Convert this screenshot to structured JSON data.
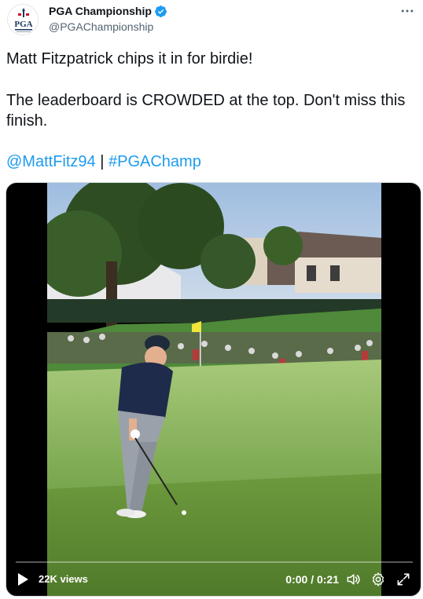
{
  "author": {
    "display_name": "PGA Championship",
    "handle": "@PGAChampionship",
    "avatar_lettering": "PGA"
  },
  "tweet": {
    "line1": "Matt Fitzpatrick chips it in for birdie!",
    "line2": "The leaderboard is CROWDED at the top. Don't miss this finish.",
    "mention": "@MattFitz94",
    "separator": " | ",
    "hashtag": "#PGAChamp"
  },
  "video": {
    "views": "22K views",
    "time": "0:00 / 0:21",
    "progress": 0
  },
  "icons": {
    "more": "more-horizontal-icon",
    "verified": "verified-badge-icon",
    "play": "play-icon",
    "volume": "volume-icon",
    "settings": "settings-gear-icon",
    "fullscreen": "fullscreen-icon"
  },
  "colors": {
    "link": "#1d9bf0",
    "verified": "#1d9bf0",
    "text": "#0f1419",
    "secondary": "#536471"
  }
}
